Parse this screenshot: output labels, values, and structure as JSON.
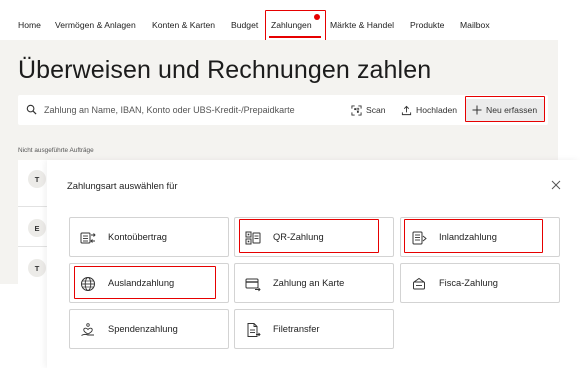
{
  "nav": {
    "items": [
      {
        "label": "Home"
      },
      {
        "label": "Vermögen & Anlagen"
      },
      {
        "label": "Konten & Karten"
      },
      {
        "label": "Budget"
      },
      {
        "label": "Zahlungen"
      },
      {
        "label": "Märkte & Handel"
      },
      {
        "label": "Produkte"
      },
      {
        "label": "Mailbox"
      }
    ],
    "active": "Zahlungen"
  },
  "page": {
    "title": "Überweisen und Rechnungen zahlen"
  },
  "search": {
    "placeholder": "Zahlung an Name, IBAN, Konto oder UBS-Kredit-/Prepaidkarte",
    "scan_label": "Scan",
    "upload_label": "Hochladen",
    "new_label": "Neu erfassen"
  },
  "orders": {
    "section_label": "Nicht ausgeführte Aufträge",
    "avatars": [
      "T",
      "E",
      "T"
    ]
  },
  "modal": {
    "title": "Zahlungsart auswählen für",
    "options": [
      {
        "label": "Kontoübertrag",
        "icon": "account-transfer-icon"
      },
      {
        "label": "QR-Zahlung",
        "icon": "qr-code-icon"
      },
      {
        "label": "Inlandzahlung",
        "icon": "domestic-payment-icon"
      },
      {
        "label": "Auslandzahlung",
        "icon": "globe-icon"
      },
      {
        "label": "Zahlung an Karte",
        "icon": "card-payment-icon"
      },
      {
        "label": "Fisca-Zahlung",
        "icon": "tax-payment-icon"
      },
      {
        "label": "Spendenzahlung",
        "icon": "donation-icon"
      },
      {
        "label": "Filetransfer",
        "icon": "file-transfer-icon"
      }
    ]
  },
  "colors": {
    "accent": "#e60000",
    "panel_background": "#f4f3f0",
    "border": "#d3d3d3"
  }
}
